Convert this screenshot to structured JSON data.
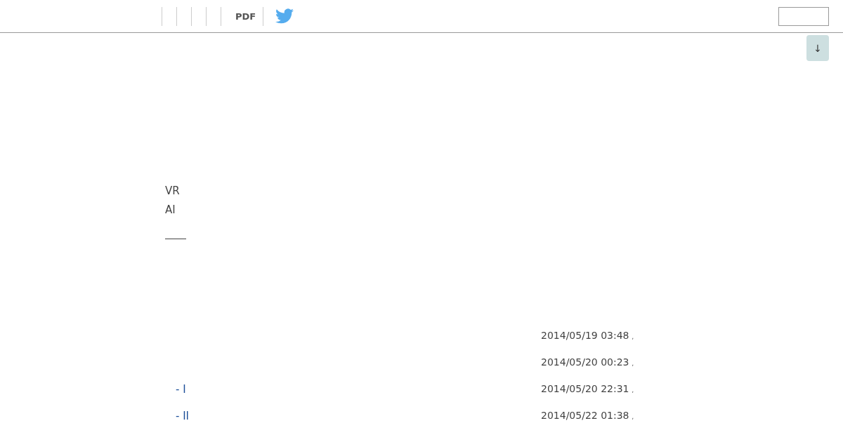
{
  "toolbar": {
    "pdf_label": "PDF"
  },
  "scroll_button": {
    "label": "↓"
  },
  "body_lines": [
    "VR",
    "AI"
  ],
  "entries": [
    {
      "date": "2014/05/19 03:48",
      "mark": ","
    },
    {
      "date": "2014/05/20 00:23",
      "mark": ","
    },
    {
      "link": "- I",
      "date": "2014/05/20 22:31",
      "mark": ","
    },
    {
      "link": "- II",
      "date": "2014/05/22 01:38",
      "mark": ","
    }
  ]
}
